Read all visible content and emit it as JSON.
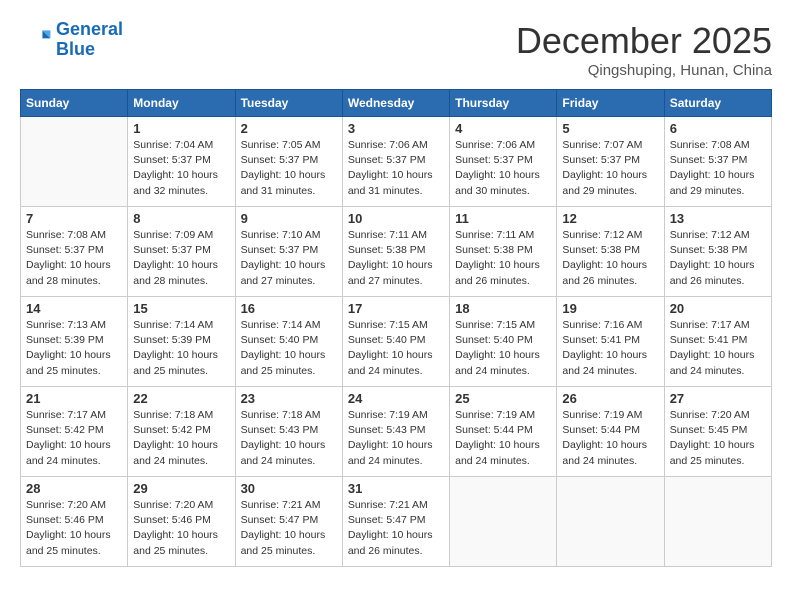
{
  "header": {
    "logo_line1": "General",
    "logo_line2": "Blue",
    "month": "December 2025",
    "location": "Qingshuping, Hunan, China"
  },
  "days_of_week": [
    "Sunday",
    "Monday",
    "Tuesday",
    "Wednesday",
    "Thursday",
    "Friday",
    "Saturday"
  ],
  "weeks": [
    [
      {
        "day": "",
        "info": ""
      },
      {
        "day": "1",
        "info": "Sunrise: 7:04 AM\nSunset: 5:37 PM\nDaylight: 10 hours\nand 32 minutes."
      },
      {
        "day": "2",
        "info": "Sunrise: 7:05 AM\nSunset: 5:37 PM\nDaylight: 10 hours\nand 31 minutes."
      },
      {
        "day": "3",
        "info": "Sunrise: 7:06 AM\nSunset: 5:37 PM\nDaylight: 10 hours\nand 31 minutes."
      },
      {
        "day": "4",
        "info": "Sunrise: 7:06 AM\nSunset: 5:37 PM\nDaylight: 10 hours\nand 30 minutes."
      },
      {
        "day": "5",
        "info": "Sunrise: 7:07 AM\nSunset: 5:37 PM\nDaylight: 10 hours\nand 29 minutes."
      },
      {
        "day": "6",
        "info": "Sunrise: 7:08 AM\nSunset: 5:37 PM\nDaylight: 10 hours\nand 29 minutes."
      }
    ],
    [
      {
        "day": "7",
        "info": "Sunrise: 7:08 AM\nSunset: 5:37 PM\nDaylight: 10 hours\nand 28 minutes."
      },
      {
        "day": "8",
        "info": "Sunrise: 7:09 AM\nSunset: 5:37 PM\nDaylight: 10 hours\nand 28 minutes."
      },
      {
        "day": "9",
        "info": "Sunrise: 7:10 AM\nSunset: 5:37 PM\nDaylight: 10 hours\nand 27 minutes."
      },
      {
        "day": "10",
        "info": "Sunrise: 7:11 AM\nSunset: 5:38 PM\nDaylight: 10 hours\nand 27 minutes."
      },
      {
        "day": "11",
        "info": "Sunrise: 7:11 AM\nSunset: 5:38 PM\nDaylight: 10 hours\nand 26 minutes."
      },
      {
        "day": "12",
        "info": "Sunrise: 7:12 AM\nSunset: 5:38 PM\nDaylight: 10 hours\nand 26 minutes."
      },
      {
        "day": "13",
        "info": "Sunrise: 7:12 AM\nSunset: 5:38 PM\nDaylight: 10 hours\nand 26 minutes."
      }
    ],
    [
      {
        "day": "14",
        "info": "Sunrise: 7:13 AM\nSunset: 5:39 PM\nDaylight: 10 hours\nand 25 minutes."
      },
      {
        "day": "15",
        "info": "Sunrise: 7:14 AM\nSunset: 5:39 PM\nDaylight: 10 hours\nand 25 minutes."
      },
      {
        "day": "16",
        "info": "Sunrise: 7:14 AM\nSunset: 5:40 PM\nDaylight: 10 hours\nand 25 minutes."
      },
      {
        "day": "17",
        "info": "Sunrise: 7:15 AM\nSunset: 5:40 PM\nDaylight: 10 hours\nand 24 minutes."
      },
      {
        "day": "18",
        "info": "Sunrise: 7:15 AM\nSunset: 5:40 PM\nDaylight: 10 hours\nand 24 minutes."
      },
      {
        "day": "19",
        "info": "Sunrise: 7:16 AM\nSunset: 5:41 PM\nDaylight: 10 hours\nand 24 minutes."
      },
      {
        "day": "20",
        "info": "Sunrise: 7:17 AM\nSunset: 5:41 PM\nDaylight: 10 hours\nand 24 minutes."
      }
    ],
    [
      {
        "day": "21",
        "info": "Sunrise: 7:17 AM\nSunset: 5:42 PM\nDaylight: 10 hours\nand 24 minutes."
      },
      {
        "day": "22",
        "info": "Sunrise: 7:18 AM\nSunset: 5:42 PM\nDaylight: 10 hours\nand 24 minutes."
      },
      {
        "day": "23",
        "info": "Sunrise: 7:18 AM\nSunset: 5:43 PM\nDaylight: 10 hours\nand 24 minutes."
      },
      {
        "day": "24",
        "info": "Sunrise: 7:19 AM\nSunset: 5:43 PM\nDaylight: 10 hours\nand 24 minutes."
      },
      {
        "day": "25",
        "info": "Sunrise: 7:19 AM\nSunset: 5:44 PM\nDaylight: 10 hours\nand 24 minutes."
      },
      {
        "day": "26",
        "info": "Sunrise: 7:19 AM\nSunset: 5:44 PM\nDaylight: 10 hours\nand 24 minutes."
      },
      {
        "day": "27",
        "info": "Sunrise: 7:20 AM\nSunset: 5:45 PM\nDaylight: 10 hours\nand 25 minutes."
      }
    ],
    [
      {
        "day": "28",
        "info": "Sunrise: 7:20 AM\nSunset: 5:46 PM\nDaylight: 10 hours\nand 25 minutes."
      },
      {
        "day": "29",
        "info": "Sunrise: 7:20 AM\nSunset: 5:46 PM\nDaylight: 10 hours\nand 25 minutes."
      },
      {
        "day": "30",
        "info": "Sunrise: 7:21 AM\nSunset: 5:47 PM\nDaylight: 10 hours\nand 25 minutes."
      },
      {
        "day": "31",
        "info": "Sunrise: 7:21 AM\nSunset: 5:47 PM\nDaylight: 10 hours\nand 26 minutes."
      },
      {
        "day": "",
        "info": ""
      },
      {
        "day": "",
        "info": ""
      },
      {
        "day": "",
        "info": ""
      }
    ]
  ]
}
